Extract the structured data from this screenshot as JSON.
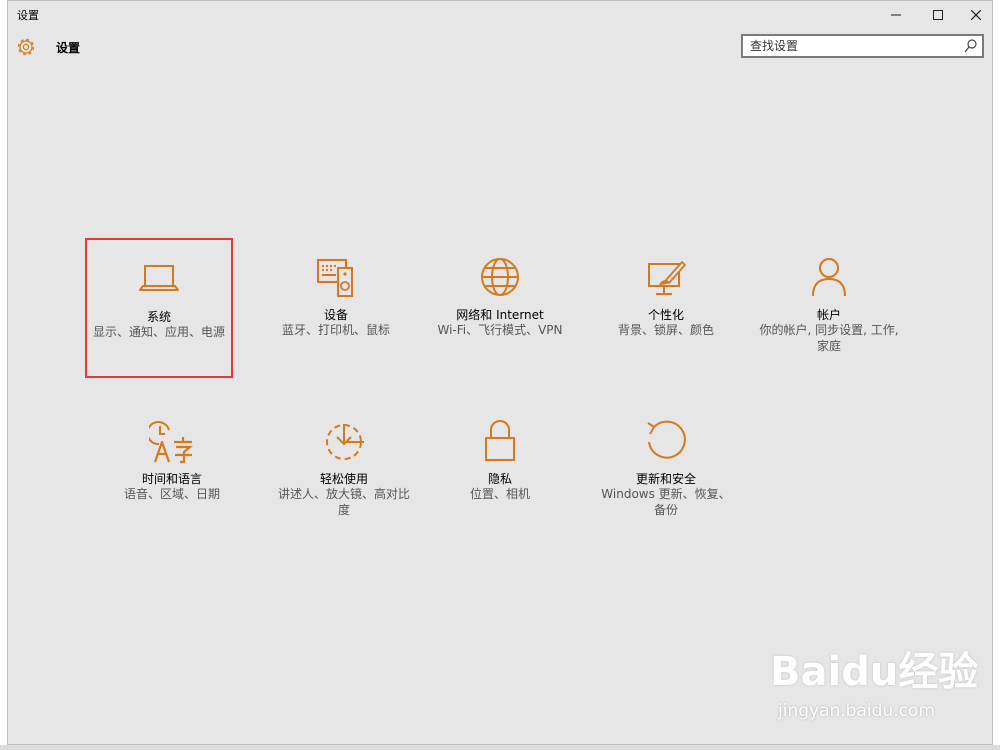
{
  "window": {
    "title": "设置",
    "minimize_glyph": "—",
    "maximize_glyph": "☐",
    "close_glyph": "✕"
  },
  "header": {
    "title": "设置",
    "icon": "gear-icon"
  },
  "search": {
    "placeholder": "查找设置",
    "icon": "search-icon"
  },
  "accent_color": "#d4791f",
  "selection_color": "#e53935",
  "tiles": [
    {
      "name": "系统",
      "desc": "显示、通知、应用、电源",
      "icon": "laptop-icon",
      "selected": true
    },
    {
      "name": "设备",
      "desc": "蓝牙、打印机、鼠标",
      "icon": "devices-icon",
      "selected": false
    },
    {
      "name": "网络和 Internet",
      "desc": "Wi-Fi、飞行模式、VPN",
      "icon": "globe-icon",
      "selected": false
    },
    {
      "name": "个性化",
      "desc": "背景、锁屏、颜色",
      "icon": "personalize-icon",
      "selected": false
    },
    {
      "name": "帐户",
      "desc": "你的帐户, 同步设置, 工作, 家庭",
      "icon": "person-icon",
      "selected": false
    },
    {
      "name": "时间和语言",
      "desc": "语音、区域、日期",
      "icon": "time-language-icon",
      "selected": false
    },
    {
      "name": "轻松使用",
      "desc": "讲述人、放大镜、高对比度",
      "icon": "ease-of-access-icon",
      "selected": false
    },
    {
      "name": "隐私",
      "desc": "位置、相机",
      "icon": "lock-icon",
      "selected": false
    },
    {
      "name": "更新和安全",
      "desc": "Windows 更新、恢复、备份",
      "icon": "update-icon",
      "selected": false
    }
  ],
  "watermark": {
    "logo": "Baidu经验",
    "url": "jingyan.baidu.com"
  }
}
